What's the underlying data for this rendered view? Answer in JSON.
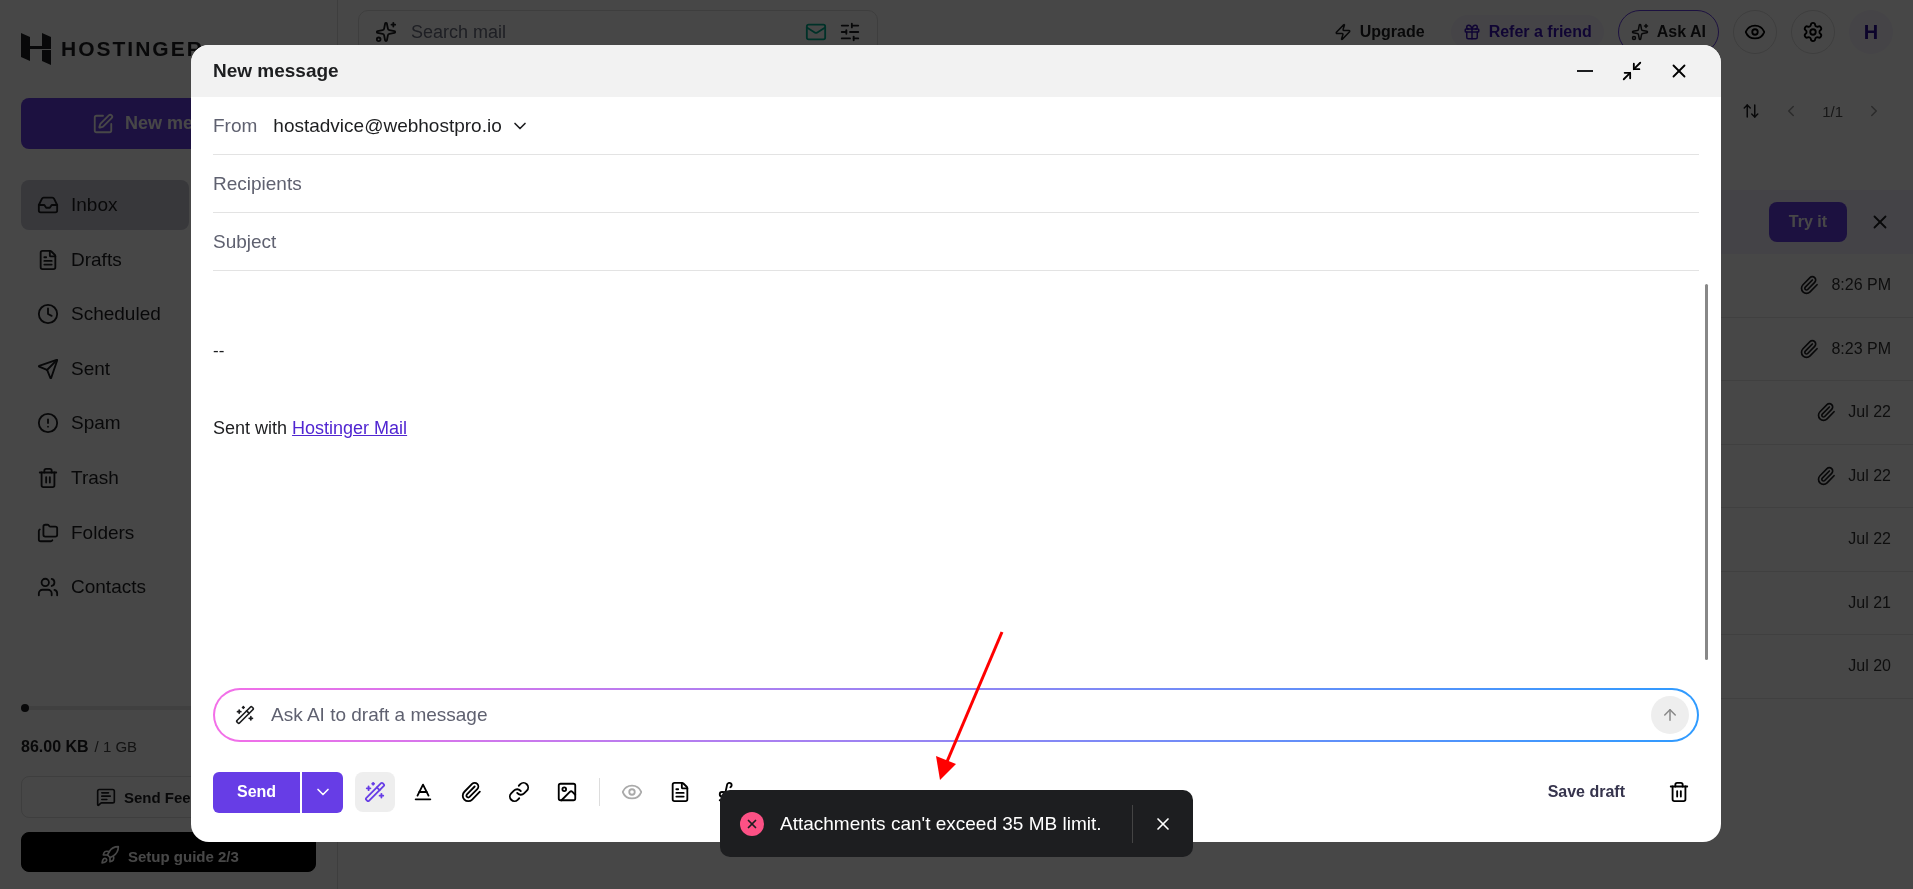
{
  "sidebar": {
    "logo": "HOSTINGER",
    "new_button": "New me",
    "items": [
      {
        "label": "Inbox",
        "kind": "inbox",
        "selected": true
      },
      {
        "label": "Drafts",
        "kind": "drafts",
        "selected": false
      },
      {
        "label": "Scheduled",
        "kind": "scheduled",
        "selected": false
      },
      {
        "label": "Sent",
        "kind": "sent",
        "selected": false
      },
      {
        "label": "Spam",
        "kind": "spam",
        "selected": false
      },
      {
        "label": "Trash",
        "kind": "trash",
        "selected": false
      },
      {
        "label": "Folders",
        "kind": "folders",
        "selected": false
      },
      {
        "label": "Contacts",
        "kind": "contacts",
        "selected": false
      }
    ],
    "storage": {
      "level": 0.01,
      "used": "86.00 KB",
      "total": "/ 1 GB"
    },
    "feedback_button": "Send Fee",
    "setup_button": "Setup guide 2/3"
  },
  "topbar": {
    "search_placeholder": "Search mail",
    "upgrade": "Upgrade",
    "refer": "Refer a friend",
    "ask_ai": "Ask AI",
    "avatar": "H"
  },
  "pager": "1/1",
  "banner": {
    "button": "Try it"
  },
  "messages": [
    {
      "time": "8:26 PM",
      "attachment": true
    },
    {
      "time": "8:23 PM",
      "attachment": true
    },
    {
      "time": "Jul 22",
      "attachment": true
    },
    {
      "time": "Jul 22",
      "attachment": true
    },
    {
      "time": "Jul 22",
      "attachment": false
    },
    {
      "time": "Jul 21",
      "attachment": false
    },
    {
      "time": "Jul 20",
      "attachment": false
    }
  ],
  "composer": {
    "title": "New message",
    "from_label": "From",
    "from_value": "hostadvice@webhostpro.io",
    "recipients_placeholder": "Recipients",
    "subject_placeholder": "Subject",
    "signature_separator": "--",
    "signature_text": "Sent with",
    "signature_link": "Hostinger Mail",
    "ai_placeholder": "Ask AI to draft a message",
    "send": "Send",
    "save_draft": "Save draft"
  },
  "toast": {
    "message": "Attachments can't exceed 35 MB limit."
  }
}
